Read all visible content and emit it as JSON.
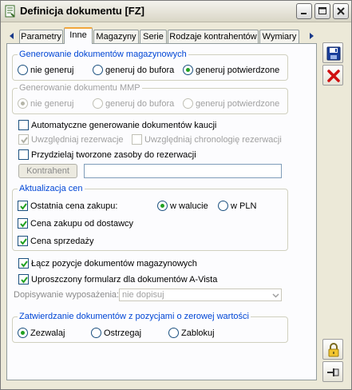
{
  "window": {
    "title": "Definicja dokumentu [FZ]"
  },
  "tabs": [
    {
      "label": "Parametry",
      "active": false
    },
    {
      "label": "Inne",
      "active": true
    },
    {
      "label": "Magazyny",
      "active": false
    },
    {
      "label": "Serie",
      "active": false
    },
    {
      "label": "Rodzaje kontrahentów",
      "active": false
    },
    {
      "label": "Wymiary",
      "active": false
    }
  ],
  "gen_mag": {
    "legend": "Generowanie dokumentów magazynowych",
    "options": [
      "nie generuj",
      "generuj do bufora",
      "generuj potwierdzone"
    ],
    "selected": "generuj potwierdzone"
  },
  "gen_mmp": {
    "legend": "Generowanie dokumentu MMP",
    "options": [
      "nie generuj",
      "generuj do bufora",
      "generuj potwierdzone"
    ],
    "selected": "nie generuj",
    "disabled": true
  },
  "checks": {
    "auto_kaucja": {
      "label": "Automatyczne generowanie dokumentów kaucji",
      "checked": false
    },
    "uwzgl_rez": {
      "label": "Uwzględniaj rezerwacje",
      "checked": true,
      "disabled": true
    },
    "uwzgl_chrono": {
      "label": "Uwzględniaj chronologię rezerwacji",
      "checked": false,
      "disabled": true
    },
    "przydzielaj": {
      "label": "Przydzielaj tworzone zasoby do rezerwacji",
      "checked": false
    },
    "lacz": {
      "label": "Łącz pozycje dokumentów magazynowych",
      "checked": true
    },
    "uproszczony": {
      "label": "Uproszczony formularz dla dokumentów A-Vista",
      "checked": true
    }
  },
  "kontrahent": {
    "button_label": "Kontrahent",
    "value": ""
  },
  "aktualizacja": {
    "legend": "Aktualizacja cen",
    "ostatnia": {
      "label": "Ostatnia cena zakupu:",
      "checked": true
    },
    "waluta_options": [
      "w walucie",
      "w PLN"
    ],
    "waluta_selected": "w walucie",
    "od_dostawcy": {
      "label": "Cena zakupu od dostawcy",
      "checked": true
    },
    "sprzedazy": {
      "label": "Cena sprzedaży",
      "checked": true
    }
  },
  "dopisywanie": {
    "label": "Dopisywanie wyposażenia:",
    "value": "nie dopisuj"
  },
  "zatwierdzanie": {
    "legend": "Zatwierdzanie dokumentów z pozycjami o zerowej wartości",
    "options": [
      "Zezwalaj",
      "Ostrzegaj",
      "Zablokuj"
    ],
    "selected": "Zezwalaj"
  },
  "icons": {
    "save": "floppy-disk-icon",
    "cancel": "red-x-icon",
    "lock": "padlock-icon",
    "pin": "pushpin-icon"
  },
  "colors": {
    "legend_blue": "#0046d5",
    "tab_active_top": "#f1a63b",
    "radio_selected": "#21a121",
    "cancel_red": "#d01010"
  }
}
